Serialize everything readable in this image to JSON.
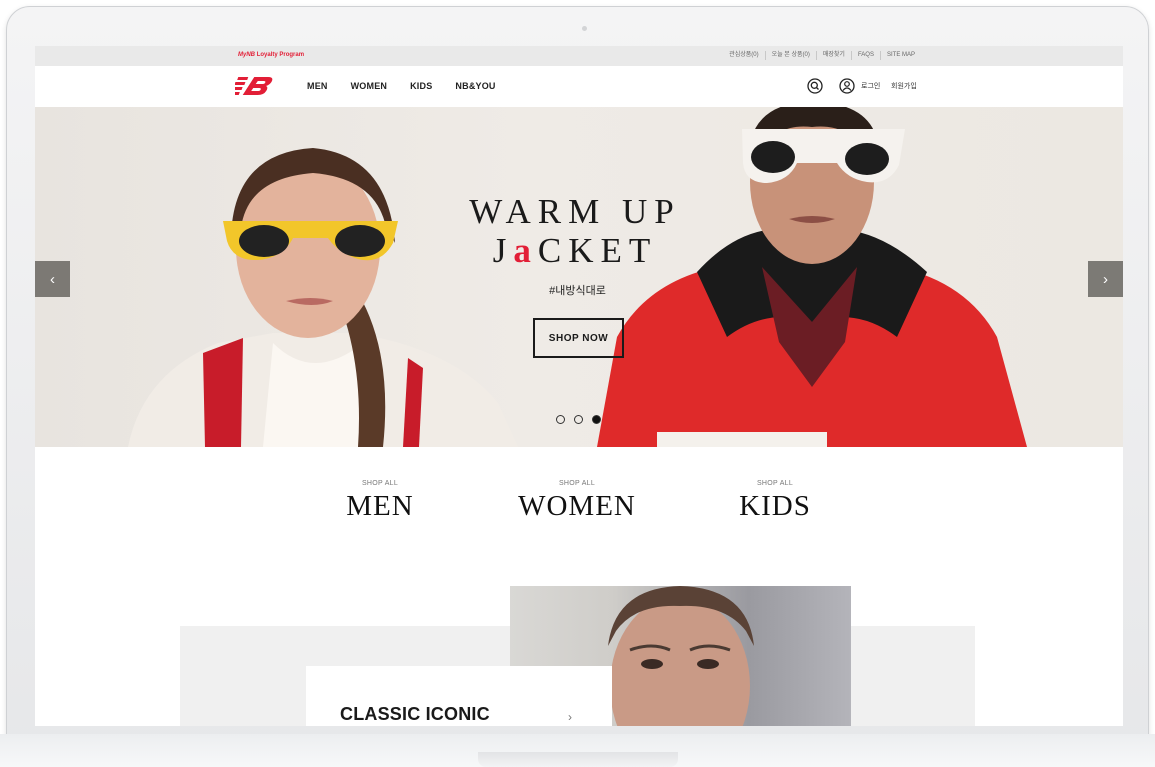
{
  "utility_bar": {
    "loyalty_prefix": "MyNB",
    "loyalty_text": "Loyalty Program",
    "links": [
      "관심상품(0)",
      "오늘 본 상품(0)",
      "매장찾기",
      "FAQS",
      "SITE MAP"
    ]
  },
  "nav": {
    "items": [
      "MEN",
      "WOMEN",
      "KIDS",
      "NB&YOU"
    ],
    "login": "로그인",
    "join": "회원가입",
    "brand_color": "#e21e36"
  },
  "hero": {
    "line1": "WARM UP",
    "line2_prefix": "J",
    "line2_accent": "a",
    "line2_suffix": "CKET",
    "hashtag": "#내방식대로",
    "cta": "SHOP NOW",
    "prev_label": "‹",
    "next_label": "›",
    "slides_total": 3,
    "active_slide": 3
  },
  "categories": [
    {
      "small": "SHOP ALL",
      "big": "MEN"
    },
    {
      "small": "SHOP ALL",
      "big": "WOMEN"
    },
    {
      "small": "SHOP ALL",
      "big": "KIDS"
    }
  ],
  "feature": {
    "title": "CLASSIC ICONIC",
    "arrow": "›"
  }
}
